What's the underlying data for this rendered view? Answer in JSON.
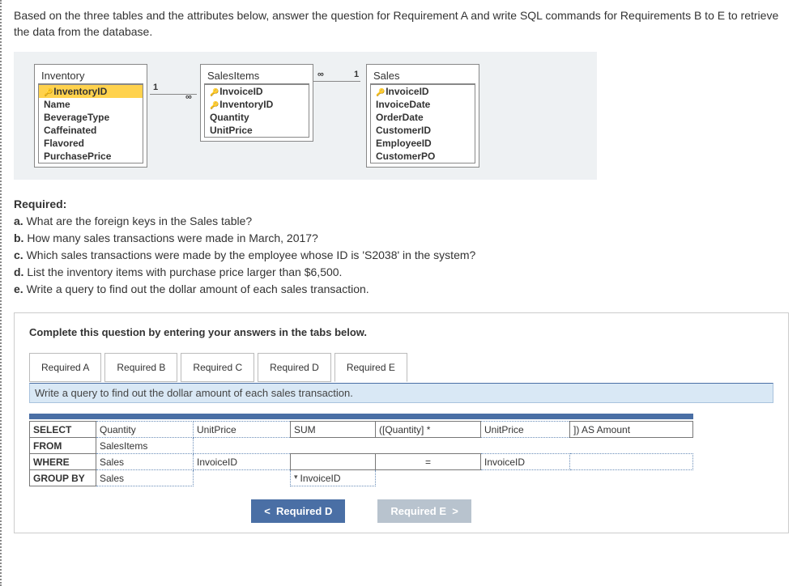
{
  "intro": "Based on the three tables and the attributes below, answer the question for Requirement A and write SQL commands for Requirements B to E to retrieve the data from the database.",
  "erd": {
    "entities": [
      {
        "name": "Inventory",
        "attrs": [
          {
            "label": "InventoryID",
            "pk": true
          },
          {
            "label": "Name"
          },
          {
            "label": "BeverageType"
          },
          {
            "label": "Caffeinated"
          },
          {
            "label": "Flavored"
          },
          {
            "label": "PurchasePrice"
          }
        ]
      },
      {
        "name": "SalesItems",
        "attrs": [
          {
            "label": "InvoiceID",
            "pk": true,
            "fk": true
          },
          {
            "label": "InventoryID",
            "pk": true,
            "fk": true
          },
          {
            "label": "Quantity"
          },
          {
            "label": "UnitPrice"
          }
        ]
      },
      {
        "name": "Sales",
        "attrs": [
          {
            "label": "InvoiceID",
            "pk": true
          },
          {
            "label": "InvoiceDate"
          },
          {
            "label": "OrderDate"
          },
          {
            "label": "CustomerID"
          },
          {
            "label": "EmployeeID"
          },
          {
            "label": "CustomerPO"
          }
        ]
      }
    ],
    "cards": {
      "left1": "1",
      "leftMany": "∞",
      "right1": "1",
      "rightMany": "∞"
    }
  },
  "required_label": "Required:",
  "requirements": {
    "a": {
      "tag": "a.",
      "text": "What are the foreign keys in the Sales table?"
    },
    "b": {
      "tag": "b.",
      "text": "How many sales transactions were made in March, 2017?"
    },
    "c": {
      "tag": "c.",
      "text": "Which sales transactions were made by the employee whose ID is 'S2038' in the system?"
    },
    "d": {
      "tag": "d.",
      "text": "List the inventory items with purchase price larger than $6,500."
    },
    "e": {
      "tag": "e.",
      "text": "Write a query to find out the dollar amount of each sales transaction."
    }
  },
  "answer": {
    "instruction": "Complete this question by entering your answers in the tabs below.",
    "tabs": [
      {
        "label": "Required A"
      },
      {
        "label": "Required B"
      },
      {
        "label": "Required C"
      },
      {
        "label": "Required D"
      },
      {
        "label": "Required E"
      }
    ],
    "active_prompt": "Write a query to find out the dollar amount of each sales transaction.",
    "sql": {
      "select": {
        "kw": "SELECT",
        "c1": "Quantity",
        "c2": "UnitPrice",
        "c3": "SUM",
        "c4": "([Quantity] *",
        "c5": "UnitPrice",
        "c6": "]) AS Amount"
      },
      "from": {
        "kw": "FROM",
        "c1": "SalesItems"
      },
      "where": {
        "kw": "WHERE",
        "c1": "Sales",
        "c2": "InvoiceID",
        "c3": "",
        "c4": "=",
        "c5": "InvoiceID",
        "c6": ""
      },
      "group": {
        "kw": "GROUP BY",
        "c1": "Sales",
        "c3dd": "InvoiceID"
      }
    },
    "nav": {
      "prev": "Required D",
      "next": "Required E"
    }
  }
}
